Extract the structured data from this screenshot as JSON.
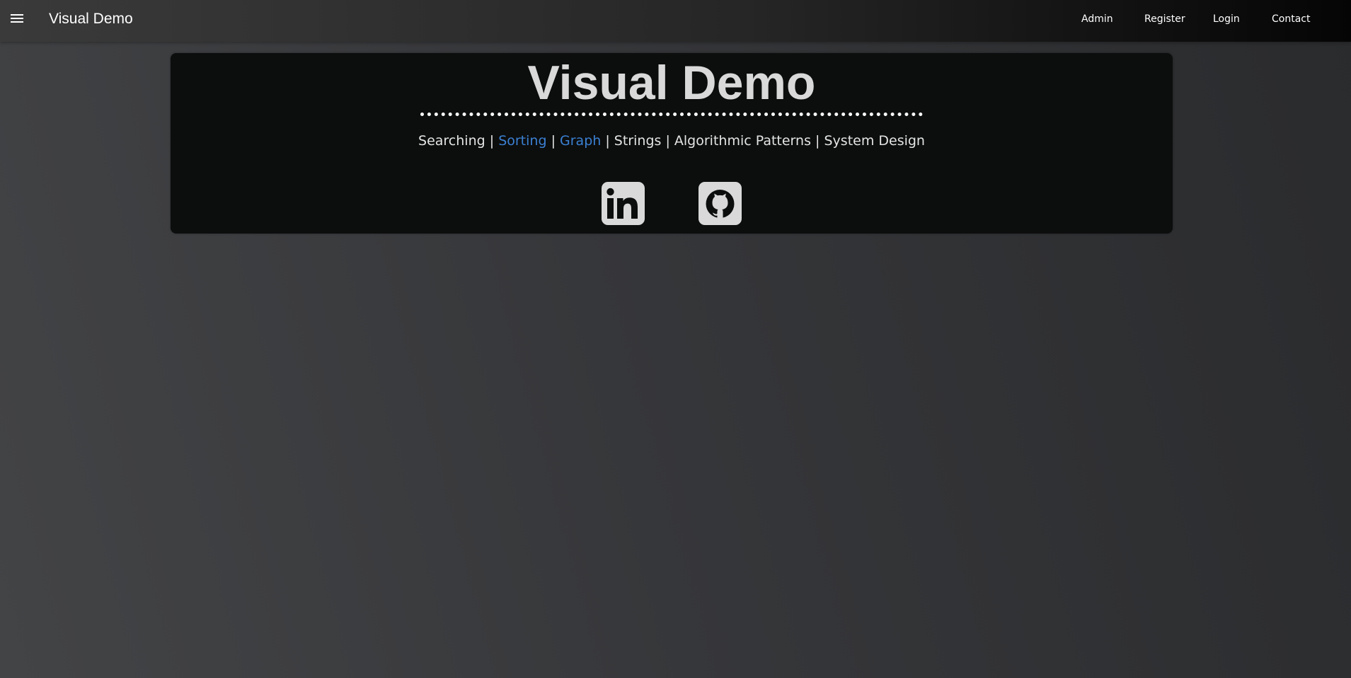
{
  "navbar": {
    "brand": "Visual Demo",
    "menu_icon": "hamburger-menu-icon",
    "links": {
      "admin": "Admin",
      "register": "Register",
      "login": "Login",
      "contact": "Contact"
    }
  },
  "hero": {
    "title": "Visual Demo",
    "separator": "|",
    "topics": {
      "searching": "Searching",
      "sorting": "Sorting",
      "graph": "Graph",
      "strings": "Strings",
      "algorithmic_patterns": "Algorithmic Patterns",
      "system_design": "System Design"
    },
    "active_topics": [
      "Sorting",
      "Graph"
    ],
    "social": {
      "linkedin_icon": "linkedin-icon",
      "github_icon": "github-icon"
    }
  },
  "colors": {
    "accent": "#3a80d2",
    "title": "#d9d9d9",
    "card_bg": "#0c0d0d",
    "icon_fill": "#d9d9d9"
  }
}
